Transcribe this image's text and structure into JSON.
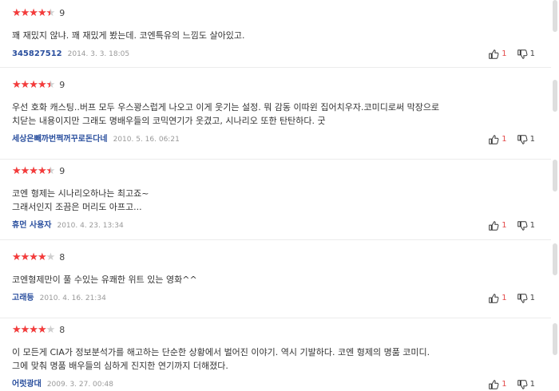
{
  "colors": {
    "star_active": "#f53b3b",
    "star_inactive": "#cfcfcf",
    "nickname": "#2a4f9e",
    "like_count": "#e34a4a"
  },
  "reviews": [
    {
      "rating": 4.5,
      "score": "9",
      "text": "꽤 재밌지 않냐. 꽤 재밌게 봤는데. 코엔특유의 느낌도 살아있고.",
      "user": "345827512",
      "date": "2014. 3. 3. 18:05",
      "likes": "1",
      "dislikes": "1"
    },
    {
      "rating": 4.5,
      "score": "9",
      "text": "우선 호화 캐스팅..버프 모두 우스꽝스럽게 나오고 이게 웃기는 설정. 뭐 감동 이따윈 집어치우자.코미디로써 막장으로\n치닫는 내용이지만 그래도 명배우들의 코믹연기가 웃겼고, 시나리오 또한 탄탄하다. 굿",
      "user": "세상은빼까번쩍꺼꾸로돈다네",
      "date": "2010. 5. 16. 06:21",
      "likes": "1",
      "dislikes": "1"
    },
    {
      "rating": 4.5,
      "score": "9",
      "text": "코엔 형제는 시나리오하나는 최고죠~\n그래서인지 조끔은 머리도 아프고...",
      "user": "휴먼 사용자",
      "date": "2010. 4. 23. 13:34",
      "likes": "1",
      "dislikes": "1"
    },
    {
      "rating": 4.0,
      "score": "8",
      "text": "코엔형제만이 풀 수있는 유쾌한 위트 있는 영화^^",
      "user": "고래등",
      "date": "2010. 4. 16. 21:34",
      "likes": "1",
      "dislikes": "1"
    },
    {
      "rating": 4.0,
      "score": "8",
      "text": "이 모든게 CIA가 정보분석가를 해고하는 단순한 상황에서 벌어진 이야기. 역시 기발하다. 코엔 형제의 명품 코미디.\n그에 맞춰 명품 배우들의 심하게 진지한 연기까지 더해졌다.",
      "user": "어럿광대",
      "date": "2009. 3. 27. 00:48",
      "likes": "1",
      "dislikes": "1"
    }
  ]
}
